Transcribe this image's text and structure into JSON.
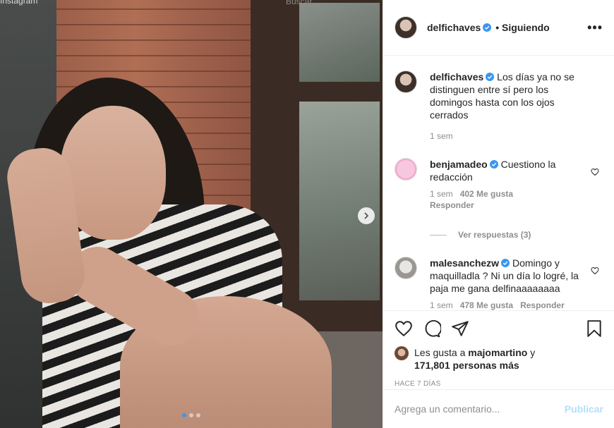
{
  "topbar": {
    "logo_text": "Instagram",
    "search_placeholder": "Buscar"
  },
  "post": {
    "author": "delfichaves",
    "follow_status": "• Siguiendo",
    "more_icon": "more-horizontal-icon",
    "caption": "Los días ya no se distinguen entre sí pero los domingos hasta con los ojos cerrados",
    "caption_time": "1 sem",
    "carousel": {
      "slides": 3,
      "current": 1
    },
    "comments": [
      {
        "user": "benjamadeo",
        "text": "Cuestiono la redacción",
        "time": "1 sem",
        "likes": "402 Me gusta",
        "reply_label": "Responder",
        "view_replies": "Ver respuestas (3)"
      },
      {
        "user": "malesanchezw",
        "text": "Domingo y maquilladla ? Ni un día lo logré, la paja me gana delfinaaaaaaaa",
        "time": "1 sem",
        "likes": "478 Me gusta",
        "reply_label": "Responder"
      }
    ],
    "likes_prefix": "Les gusta a",
    "likes_user": "majomartino",
    "likes_and": "y",
    "likes_count": "171,801 personas más",
    "date": "HACE 7 DÍAS",
    "comment_placeholder": "Agrega un comentario...",
    "publish_label": "Publicar"
  },
  "colors": {
    "accent": "#3897f0",
    "publish_disabled": "#b2dffc",
    "muted": "#8e8e8e"
  }
}
